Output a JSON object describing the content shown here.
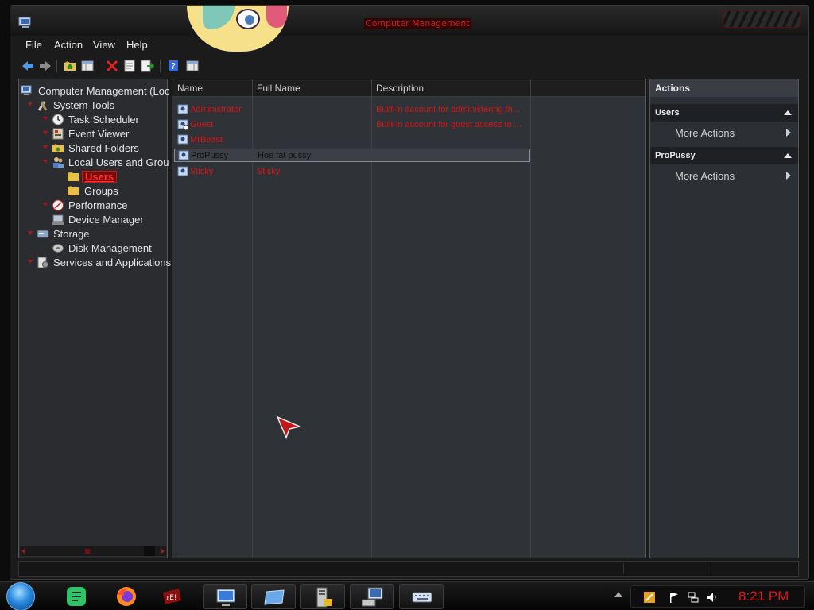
{
  "window": {
    "title": "Computer Management"
  },
  "menu": {
    "items": [
      "File",
      "Action",
      "View",
      "Help"
    ]
  },
  "toolbar": {
    "buttons": [
      "back-icon",
      "forward-icon",
      "up-folder-icon",
      "show-hide-tree-icon",
      "delete-icon",
      "properties-icon",
      "export-list-icon",
      "help-icon",
      "show-hide-action-pane-icon"
    ]
  },
  "tree": {
    "root": "Computer Management (Loc",
    "items": [
      {
        "label": "System Tools",
        "icon": "tools-icon"
      },
      {
        "label": "Task Scheduler",
        "icon": "clock-icon"
      },
      {
        "label": "Event Viewer",
        "icon": "event-viewer-icon"
      },
      {
        "label": "Shared Folders",
        "icon": "shared-folders-icon"
      },
      {
        "label": "Local Users and Grou",
        "icon": "users-icon"
      },
      {
        "label": "Users",
        "icon": "folder-icon"
      },
      {
        "label": "Groups",
        "icon": "folder-icon"
      },
      {
        "label": "Performance",
        "icon": "performance-icon"
      },
      {
        "label": "Device Manager",
        "icon": "device-manager-icon"
      },
      {
        "label": "Storage",
        "icon": "storage-icon"
      },
      {
        "label": "Disk Management",
        "icon": "disk-icon"
      },
      {
        "label": "Services and Applications",
        "icon": "services-icon"
      }
    ]
  },
  "list": {
    "columns": [
      "Name",
      "Full Name",
      "Description"
    ],
    "rows": [
      {
        "name": "Administrator",
        "full_name": "",
        "description": "Built-in account for administering th..."
      },
      {
        "name": "Guest",
        "full_name": "",
        "description": "Built-in account for guest access to ..."
      },
      {
        "name": "MrBeast",
        "full_name": "",
        "description": ""
      },
      {
        "name": "ProPussy",
        "full_name": "Hoe fat pussy",
        "description": ""
      },
      {
        "name": "Sticky",
        "full_name": "Sticky",
        "description": ""
      }
    ]
  },
  "actions": {
    "title": "Actions",
    "sections": [
      {
        "header": "Users",
        "item": "More Actions"
      },
      {
        "header": "ProPussy",
        "item": "More Actions"
      }
    ]
  },
  "taskbar": {
    "apps": [
      "start-orb",
      "notes-icon",
      "firefox-icon",
      "game-icon",
      "remote-desktop-icon",
      "window-switcher-icon",
      "server-lock-icon",
      "network-computer-icon",
      "keyboard-icon"
    ],
    "tray_icons": [
      "pinned-app-icon",
      "action-center-flag-icon",
      "network-icon",
      "volume-icon"
    ],
    "clock": "8:21 PM"
  },
  "colors": {
    "accent_red": "#e01818",
    "pane_bg": "#2f3236",
    "frame_bg": "#1b1b1b"
  }
}
